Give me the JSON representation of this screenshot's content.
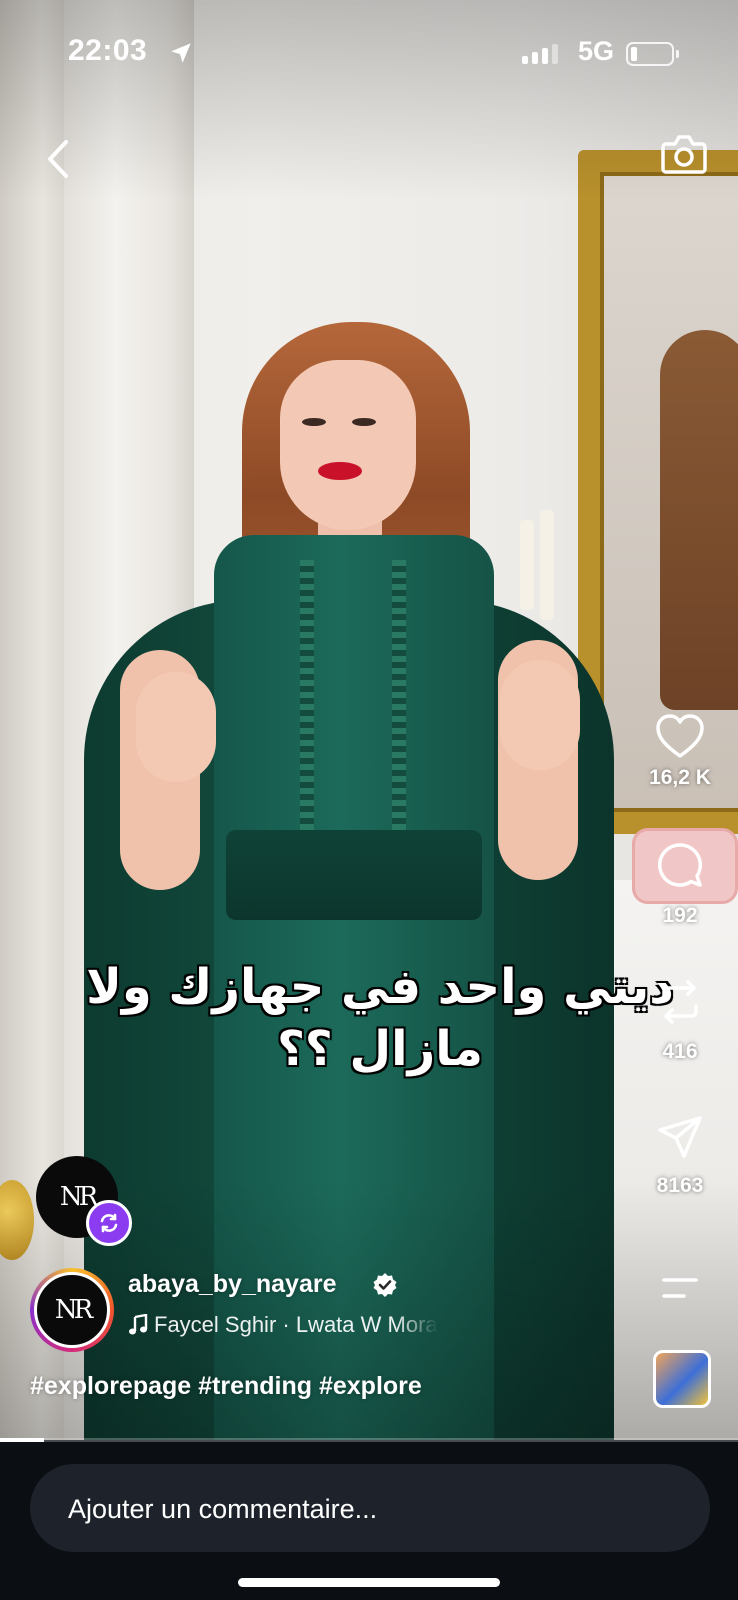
{
  "status_bar": {
    "time": "22:03",
    "network": "5G"
  },
  "video": {
    "caption": "ديتي واحد في جهازك ولا مازال ؟؟",
    "progress": 0.06
  },
  "actions": {
    "likes": "16,2 K",
    "comments": "192",
    "remixes": "416",
    "shares": "8163"
  },
  "post": {
    "username": "abaya_by_nayare",
    "audio": "Faycel Sghir · Lwata W Mora",
    "hashtags": "#explorepage #trending #explore"
  },
  "comment_bar": {
    "placeholder": "Ajouter un commentaire..."
  },
  "icons": {
    "back": "chevron-left-icon",
    "camera": "camera-icon",
    "like": "heart-icon",
    "comment": "comment-bubble-icon",
    "remix": "repost-icon",
    "share": "send-icon",
    "more": "menu-lines-icon",
    "verified": "verified-badge-icon",
    "music": "music-note-icon"
  },
  "colors": {
    "accent_badge": "#8b3cf0",
    "background": "#0b0f14",
    "comment_field": "#1e232b"
  }
}
